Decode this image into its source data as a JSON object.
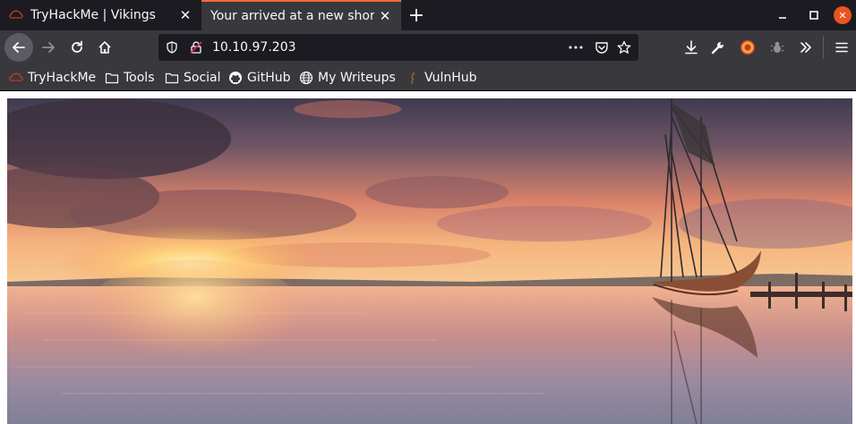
{
  "tabs": [
    {
      "title": "TryHackMe | Vikings",
      "active": false
    },
    {
      "title": "Your arrived at a new shore!",
      "active": true
    }
  ],
  "address_bar": {
    "url": "10.10.97.203"
  },
  "bookmarks": [
    {
      "label": "TryHackMe",
      "icon": "tryhackme-icon"
    },
    {
      "label": "Tools",
      "icon": "folder-icon"
    },
    {
      "label": "Social",
      "icon": "folder-icon"
    },
    {
      "label": "GitHub",
      "icon": "github-icon"
    },
    {
      "label": "My Writeups",
      "icon": "globe-icon"
    },
    {
      "label": "VulnHub",
      "icon": "vulnhub-icon"
    }
  ],
  "page": {
    "hero_image": "sunset-lake-viking-ship"
  },
  "colors": {
    "tab_accent": "#ff6a3d",
    "toolbar": "#38383d",
    "tabstrip": "#1c1b22"
  }
}
